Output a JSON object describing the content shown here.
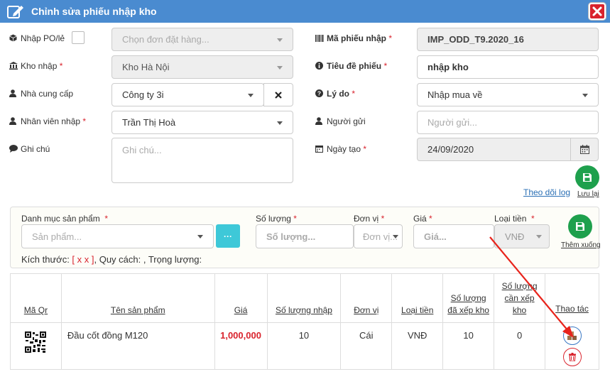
{
  "dialog": {
    "title": "Chỉnh sửa phiếu nhập kho"
  },
  "form": {
    "po_label": "Nhập PO/lẻ",
    "po_placeholder": "Chọn đơn đặt hàng...",
    "warehouse_label": "Kho nhập",
    "warehouse_value": "Kho Hà Nội",
    "supplier_label": "Nhà cung cấp",
    "supplier_value": "Công ty 3i",
    "staff_label": "Nhân viên nhập",
    "staff_value": "Trần Thị Hoà",
    "note_label": "Ghi chú",
    "note_placeholder": "Ghi chú...",
    "code_label": "Mã phiếu nhập",
    "code_value": "IMP_ODD_T9.2020_16",
    "title_label": "Tiêu đề phiếu",
    "title_value": "nhập kho",
    "reason_label": "Lý do",
    "reason_value": "Nhập mua về",
    "sender_label": "Người gửi",
    "sender_placeholder": "Người gửi...",
    "date_label": "Ngày tạo",
    "date_value": "24/09/2020",
    "save_label": "Lưu lại",
    "log_link": "Theo dõi log",
    "required_mark": "*"
  },
  "product_panel": {
    "category_label": "Danh mục sản phẩm",
    "product_placeholder": "Sản phẩm...",
    "more_btn": "···",
    "qty_label": "Số lượng",
    "qty_placeholder": "Số lượng...",
    "unit_label": "Đơn vị",
    "unit_placeholder": "Đơn vị...",
    "price_label": "Giá",
    "price_placeholder": "Giá...",
    "currency_label": "Loại tiền",
    "currency_value": "VNĐ",
    "add_label": "Thêm xuống",
    "dims_prefix": "Kích thước: ",
    "dims_value": "[ x x ]",
    "dims_rest": ", Quy cách: , Trọng lượng:"
  },
  "table": {
    "headers": [
      "Mã Qr",
      "Tên sản phẩm",
      "Giá",
      "Số lượng nhập",
      "Đơn vị",
      "Loại tiền",
      "Số lượng đã xếp kho",
      "Số lượng cần xếp kho",
      "Thao tác"
    ],
    "rows": [
      {
        "name": "Đầu cốt đồng M120",
        "price": "1,000,000",
        "qty": "10",
        "unit": "Cái",
        "currency": "VNĐ",
        "placed": "10",
        "remaining": "0"
      }
    ]
  },
  "colors": {
    "title_bar": "#4a8bd0",
    "accent_red": "#d9232d",
    "green": "#1ea04d",
    "cyan": "#3ec8d8",
    "annotation_arrow": "#e8241c"
  }
}
